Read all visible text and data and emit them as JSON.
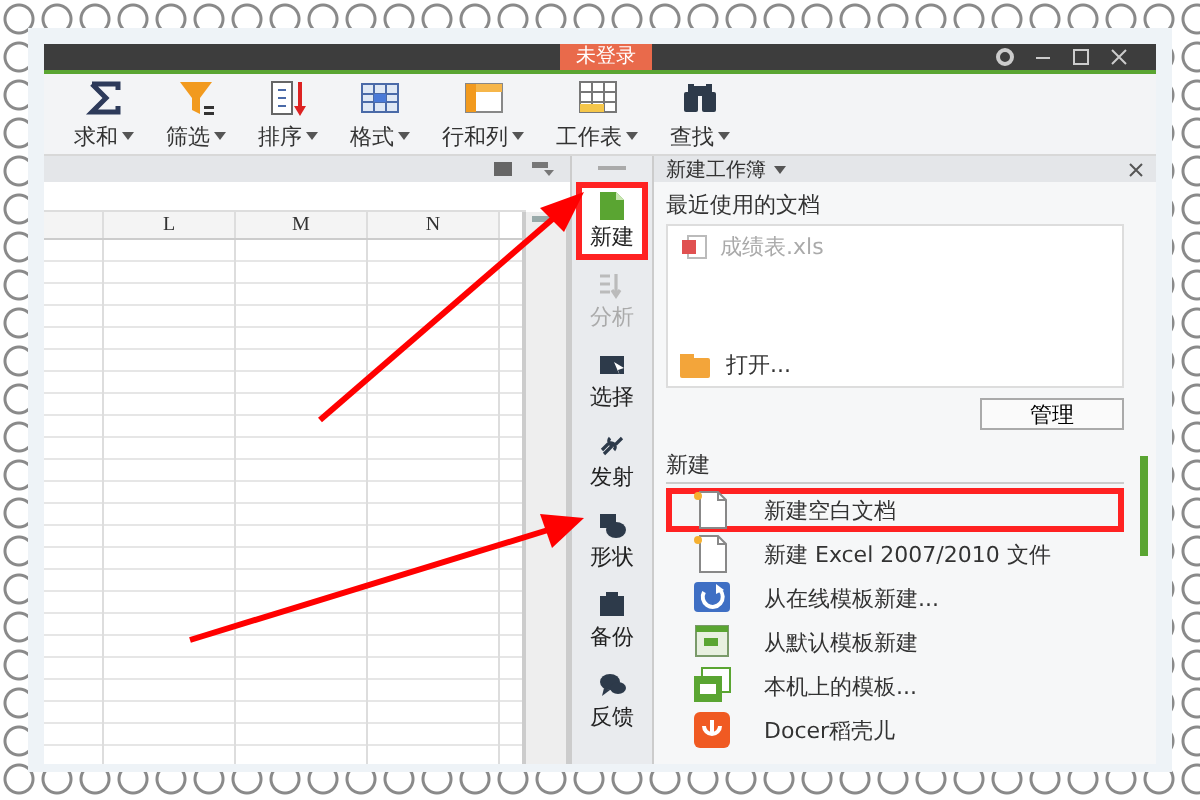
{
  "title_bar": {
    "account_button": "未登录"
  },
  "toolbar": [
    {
      "label": "求和",
      "kind": "sum"
    },
    {
      "label": "筛选",
      "kind": "filter"
    },
    {
      "label": "排序",
      "kind": "sort"
    },
    {
      "label": "格式",
      "kind": "format"
    },
    {
      "label": "行和列",
      "kind": "rowcol"
    },
    {
      "label": "工作表",
      "kind": "sheet"
    },
    {
      "label": "查找",
      "kind": "find"
    }
  ],
  "sheet": {
    "columns": [
      "L",
      "M",
      "N"
    ]
  },
  "side_tabs": [
    {
      "label": "新建",
      "kind": "new",
      "selected": true,
      "disabled": false,
      "highlighted": true
    },
    {
      "label": "分析",
      "kind": "analyze",
      "selected": false,
      "disabled": true,
      "highlighted": false
    },
    {
      "label": "选择",
      "kind": "select",
      "selected": false,
      "disabled": false,
      "highlighted": false
    },
    {
      "label": "发射",
      "kind": "link",
      "selected": false,
      "disabled": false,
      "highlighted": false
    },
    {
      "label": "形状",
      "kind": "shape",
      "selected": false,
      "disabled": false,
      "highlighted": false
    },
    {
      "label": "备份",
      "kind": "backup",
      "selected": false,
      "disabled": false,
      "highlighted": false
    },
    {
      "label": "反馈",
      "kind": "feedback",
      "selected": false,
      "disabled": false,
      "highlighted": false
    }
  ],
  "task_pane": {
    "title": "新建工作簿",
    "recent": {
      "heading": "最近使用的文档",
      "files": [
        {
          "name": "成绩表.xls",
          "disabled": true
        }
      ],
      "open_label": "打开..."
    },
    "manage_button": "管理",
    "new_section": {
      "heading": "新建",
      "items": [
        {
          "label": "新建空白文档",
          "kind": "blank",
          "highlighted": true
        },
        {
          "label": "新建 Excel 2007/2010 文件",
          "kind": "blank",
          "highlighted": false
        },
        {
          "label": "从在线模板新建...",
          "kind": "online",
          "highlighted": false
        },
        {
          "label": "从默认模板新建",
          "kind": "default",
          "highlighted": false
        },
        {
          "label": "本机上的模板...",
          "kind": "local",
          "highlighted": false
        },
        {
          "label": "Docer稻壳儿",
          "kind": "docer",
          "highlighted": false
        }
      ]
    }
  }
}
